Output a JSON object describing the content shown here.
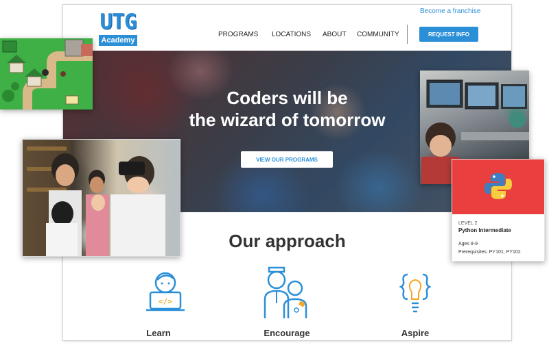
{
  "header": {
    "logo": {
      "title": "UTG",
      "subtitle": "Academy"
    },
    "franchise_link": "Become a franchise",
    "nav": [
      "PROGRAMS",
      "LOCATIONS",
      "ABOUT",
      "COMMUNITY"
    ],
    "cta": "REQUEST INFO"
  },
  "hero": {
    "title_line1": "Coders will be",
    "title_line2": "the wizard of tomorrow",
    "button": "VIEW OUR PROGRAMS"
  },
  "approach": {
    "title": "Our approach",
    "features": [
      {
        "label": "Learn",
        "icon": "laptop-coder-icon"
      },
      {
        "label": "Encourage",
        "icon": "mentor-student-icon"
      },
      {
        "label": "Aspire",
        "icon": "code-lightbulb-icon"
      }
    ]
  },
  "course_card": {
    "level": "LEVEL 2",
    "name": "Python Intermediate",
    "ages": "Ages 8-9",
    "prerequisites": "Prerequisites: PY101, PY102",
    "icon": "python-logo-icon"
  },
  "colors": {
    "accent": "#2b8fd8",
    "card_red": "#e9403f",
    "game_green": "#3fb046"
  }
}
